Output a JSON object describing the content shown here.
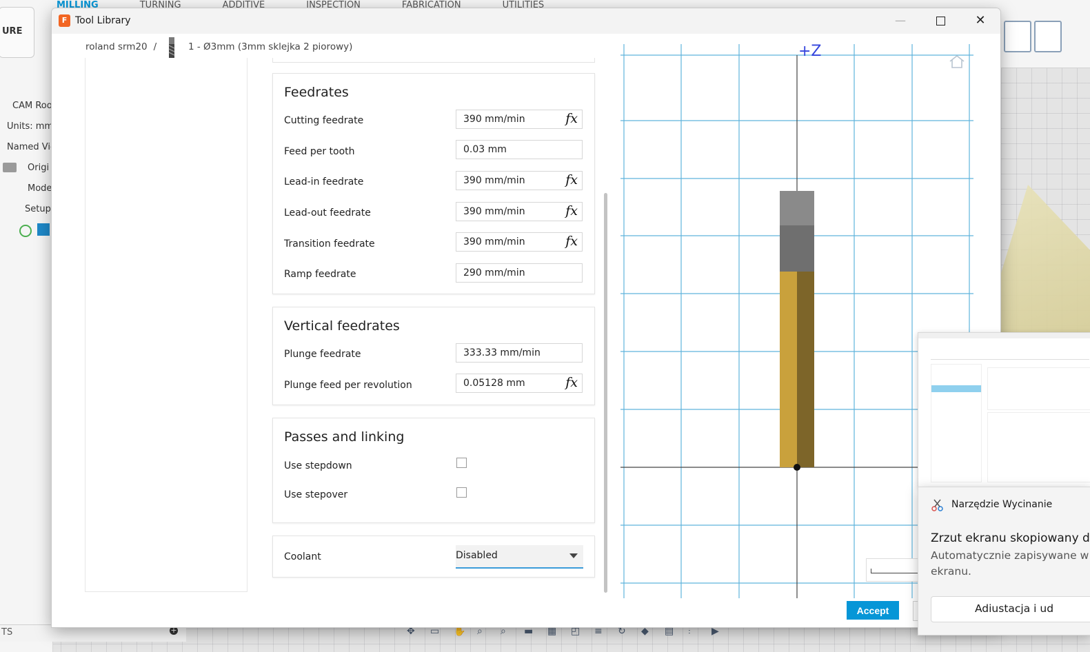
{
  "background": {
    "ribbon_tabs": [
      "MILLING",
      "TURNING",
      "ADDITIVE",
      "INSPECTION",
      "FABRICATION",
      "UTILITIES"
    ],
    "workspace_label": "URE",
    "browser_rows": [
      "CAM Roo",
      "Units: mm",
      "Named Vie",
      "Origi",
      "Mode",
      "Setups"
    ],
    "bottom_left_text": "TS"
  },
  "dialog": {
    "title": "Tool Library",
    "breadcrumb_library": "roland srm20",
    "breadcrumb_separator": "/",
    "tool_name": "1 - Ø3mm (3mm sklejka 2 piorowy)",
    "accept_label": "Accept"
  },
  "feedrates": {
    "title": "Feedrates",
    "fields": [
      {
        "label": "Cutting feedrate",
        "value": "390 mm/min",
        "has_fx": true
      },
      {
        "label": "Feed per tooth",
        "value": "0.03 mm",
        "has_fx": false
      },
      {
        "label": "Lead-in feedrate",
        "value": "390 mm/min",
        "has_fx": true
      },
      {
        "label": "Lead-out feedrate",
        "value": "390 mm/min",
        "has_fx": true
      },
      {
        "label": "Transition feedrate",
        "value": "390 mm/min",
        "has_fx": true
      },
      {
        "label": "Ramp feedrate",
        "value": "290 mm/min",
        "has_fx": false
      }
    ]
  },
  "vertical_feedrates": {
    "title": "Vertical feedrates",
    "fields": [
      {
        "label": "Plunge feedrate",
        "value": "333.33 mm/min",
        "has_fx": false
      },
      {
        "label": "Plunge feed per revolution",
        "value": "0.05128 mm",
        "has_fx": true
      }
    ]
  },
  "passes": {
    "title": "Passes and linking",
    "checkboxes": [
      {
        "label": "Use stepdown",
        "checked": false
      },
      {
        "label": "Use stepover",
        "checked": false
      }
    ]
  },
  "coolant": {
    "label": "Coolant",
    "value": "Disabled"
  },
  "viewport": {
    "axis_label": "+Z",
    "grid_color": "#5fb3dc",
    "shank_color": "#8a8a8a",
    "flute_color": "#c9a13c"
  },
  "fx_symbol": "fx",
  "snip": {
    "app": "Narzędzie Wycinanie",
    "title": "Zrzut ekranu skopiowany do",
    "body_line1": "Automatycznie zapisywane w",
    "body_line2": "ekranu.",
    "button": "Adiustacja i ud"
  }
}
